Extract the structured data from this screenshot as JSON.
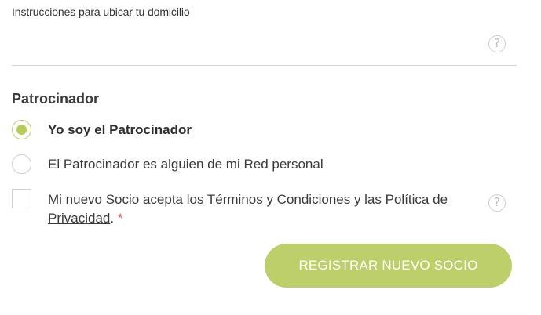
{
  "instructions": {
    "label": "Instrucciones para ubicar tu domicilio",
    "value": "",
    "help_icon": "question-circle-icon"
  },
  "sponsor": {
    "title": "Patrocinador",
    "options": [
      {
        "label": "Yo soy el Patrocinador",
        "selected": true
      },
      {
        "label": "El Patrocinador es alguien de mi Red personal",
        "selected": false
      }
    ]
  },
  "terms": {
    "checked": false,
    "text_before": "Mi nuevo Socio acepta los ",
    "terms_link": "Términos y Condiciones",
    "text_middle": " y las ",
    "privacy_link": "Política de Privacidad",
    "text_after": ".",
    "required_mark": "*",
    "help_icon": "question-circle-icon"
  },
  "submit": {
    "label": "REGISTRAR NUEVO SOCIO"
  },
  "colors": {
    "accent": "#bccf6b",
    "required": "#e05a5a",
    "border": "#cfcfcf"
  }
}
